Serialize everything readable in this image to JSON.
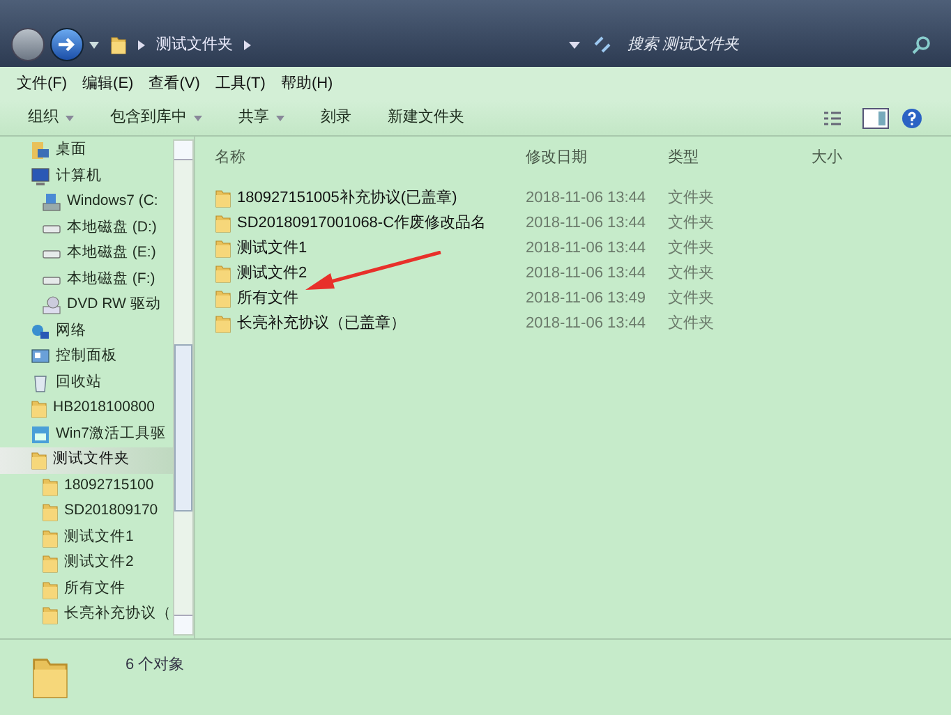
{
  "address_bar": {
    "breadcrumb": "测试文件夹",
    "search_placeholder": "搜索 测试文件夹"
  },
  "menu": [
    "文件(F)",
    "编辑(E)",
    "查看(V)",
    "工具(T)",
    "帮助(H)"
  ],
  "toolbar": [
    {
      "label": "组织",
      "dropdown": true
    },
    {
      "label": "包含到库中",
      "dropdown": true
    },
    {
      "label": "共享",
      "dropdown": true
    },
    {
      "label": "刻录",
      "dropdown": false
    },
    {
      "label": "新建文件夹",
      "dropdown": false
    }
  ],
  "sidebar": {
    "items": [
      {
        "label": "桌面",
        "kind": "desktop",
        "selected": false
      },
      {
        "label": "计算机",
        "kind": "computer",
        "selected": false,
        "children": [
          {
            "label": "Windows7 (C:",
            "kind": "system-drive",
            "selected": false
          },
          {
            "label": "本地磁盘 (D:)",
            "kind": "drive",
            "selected": false
          },
          {
            "label": "本地磁盘 (E:)",
            "kind": "drive",
            "selected": false
          },
          {
            "label": "本地磁盘 (F:)",
            "kind": "drive",
            "selected": false
          },
          {
            "label": "DVD RW 驱动",
            "kind": "dvd",
            "selected": false
          }
        ]
      },
      {
        "label": "网络",
        "kind": "network",
        "selected": false
      },
      {
        "label": "控制面板",
        "kind": "control-panel",
        "selected": false
      },
      {
        "label": "回收站",
        "kind": "recycle-bin",
        "selected": false
      },
      {
        "label": "HB2018100800",
        "kind": "folder",
        "selected": false
      },
      {
        "label": "Win7激活工具驱",
        "kind": "app",
        "selected": false
      },
      {
        "label": "测试文件夹",
        "kind": "folder",
        "selected": true,
        "children": [
          {
            "label": "18092715100",
            "kind": "folder",
            "selected": false
          },
          {
            "label": "SD201809170",
            "kind": "folder",
            "selected": false
          },
          {
            "label": "测试文件1",
            "kind": "folder",
            "selected": false
          },
          {
            "label": "测试文件2",
            "kind": "folder",
            "selected": false
          },
          {
            "label": "所有文件",
            "kind": "folder",
            "selected": false
          },
          {
            "label": "长亮补充协议（",
            "kind": "folder",
            "selected": false
          }
        ]
      }
    ]
  },
  "table": {
    "columns": [
      "名称",
      "修改日期",
      "类型",
      "大小"
    ],
    "rows": [
      {
        "name": "180927151005补充协议(已盖章)",
        "modified": "2018-11-06 13:44",
        "type": "文件夹"
      },
      {
        "name": "SD20180917001068-C作废修改品名",
        "modified": "2018-11-06 13:44",
        "type": "文件夹"
      },
      {
        "name": "测试文件1",
        "modified": "2018-11-06 13:44",
        "type": "文件夹"
      },
      {
        "name": "测试文件2",
        "modified": "2018-11-06 13:44",
        "type": "文件夹"
      },
      {
        "name": "所有文件",
        "modified": "2018-11-06 13:49",
        "type": "文件夹"
      },
      {
        "name": "长亮补充协议（已盖章）",
        "modified": "2018-11-06 13:44",
        "type": "文件夹"
      }
    ]
  },
  "status_bar": {
    "text": "6 个对象"
  }
}
